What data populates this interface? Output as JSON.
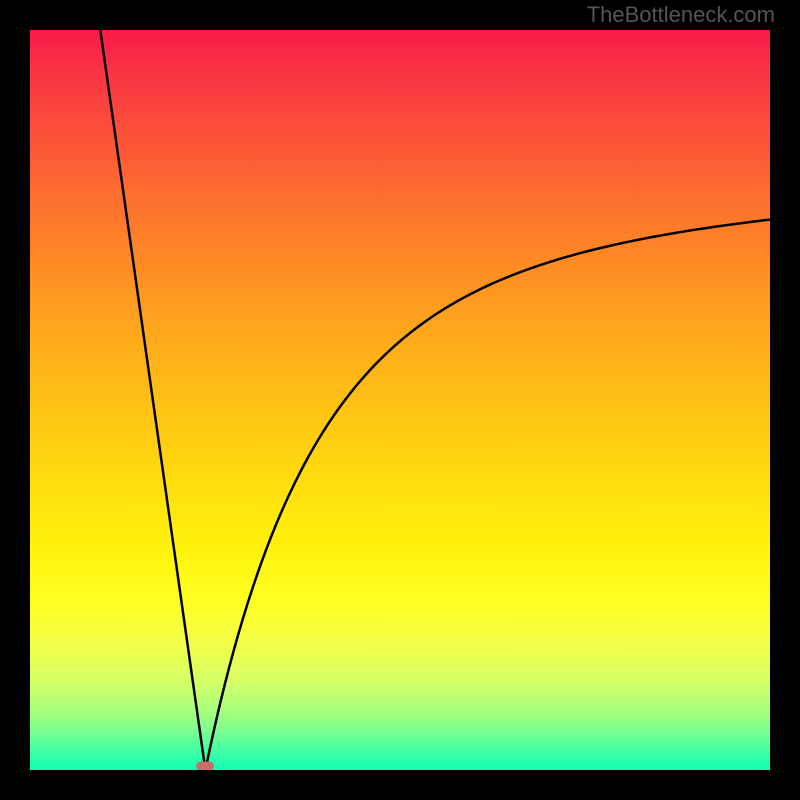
{
  "watermark": "TheBottleneck.com",
  "chart_data": {
    "type": "line",
    "title": "",
    "xlabel": "",
    "ylabel": "",
    "x_range": [
      0,
      1
    ],
    "y_range": [
      0,
      1
    ],
    "minimum": {
      "x": 0.237,
      "y": 0.0
    },
    "series": [
      {
        "name": "bottleneck-curve",
        "description": "V-shaped bottleneck curve with steep linear left descent and asymptotic right ascent",
        "segments": {
          "left_branch": {
            "type": "line",
            "start": {
              "x": 0.095,
              "y": 1.0
            },
            "end": {
              "x": 0.237,
              "y": 0.0
            }
          },
          "right_branch": {
            "type": "asymptotic-curve",
            "start": {
              "x": 0.237,
              "y": 0.0
            },
            "end": {
              "x": 1.0,
              "y": 0.85
            }
          }
        }
      }
    ]
  },
  "colors": {
    "background": "#000000",
    "marker": "#c56f6a",
    "curve": "#000000",
    "watermark": "#555555"
  }
}
